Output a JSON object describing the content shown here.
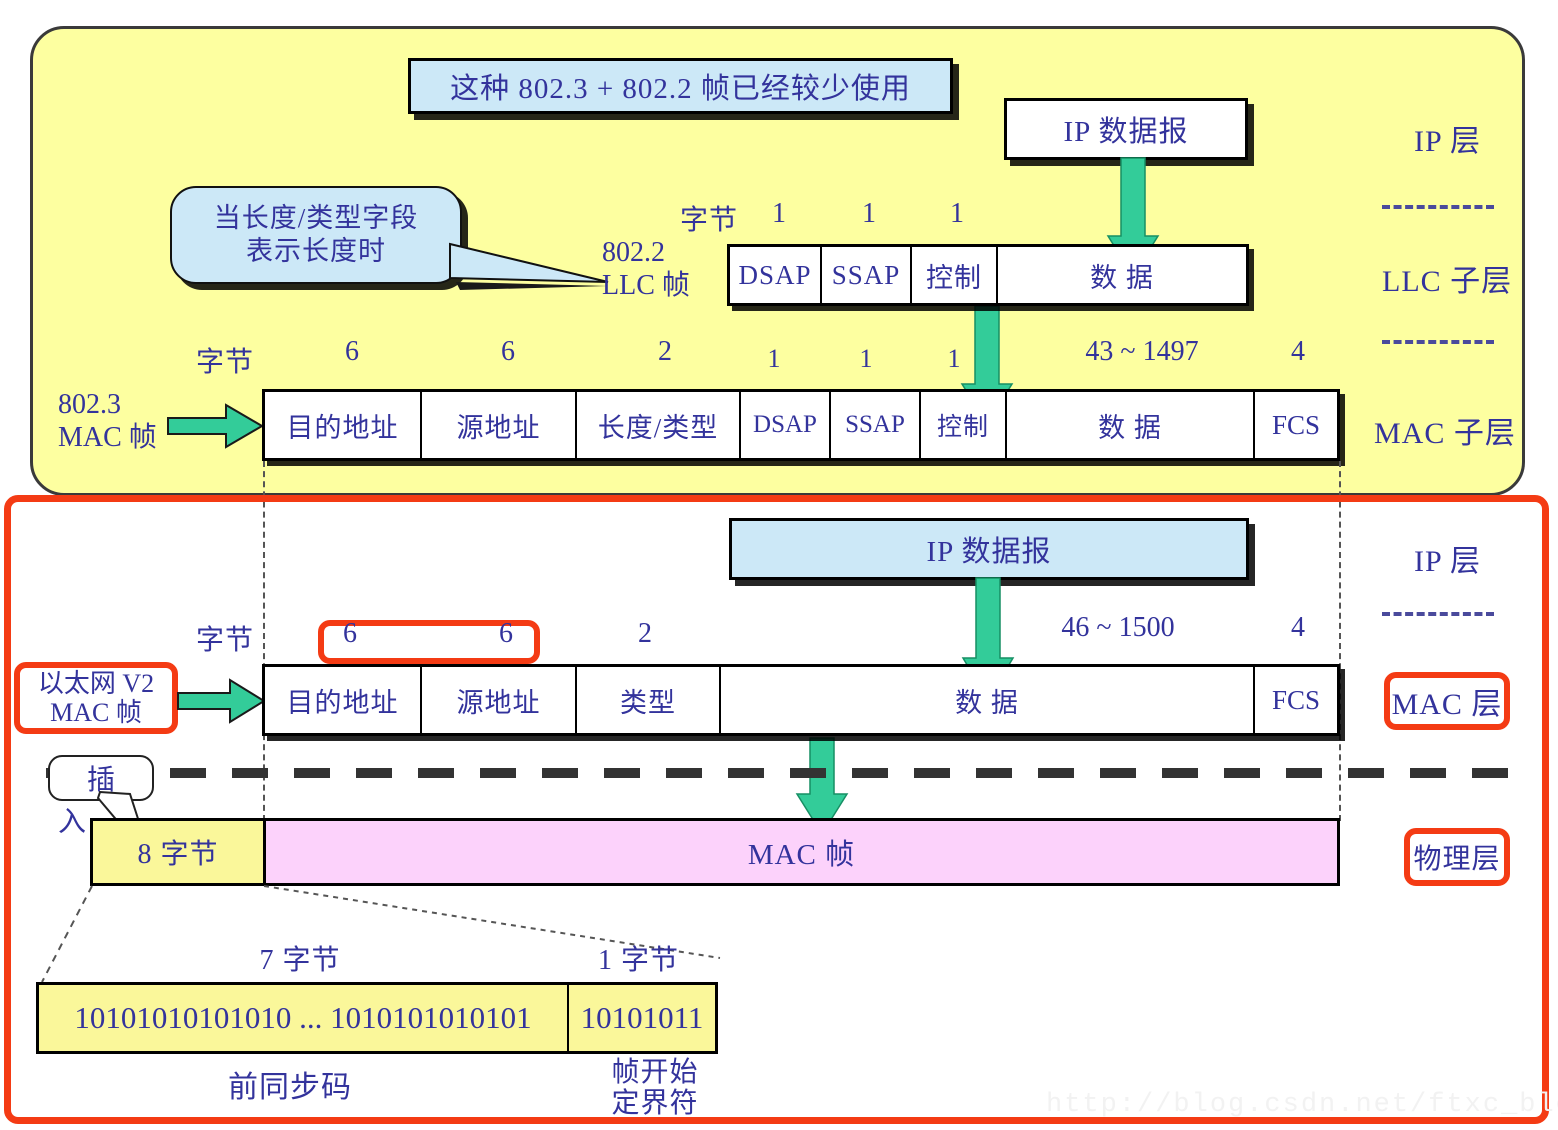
{
  "meta": {
    "watermark": "http://blog.csdn.net/ftxc_blog"
  },
  "top_section": {
    "note_banner": "这种 802.3 + 802.2 帧已经较少使用",
    "callout_length_field": "当长度/类型字段\n表示长度时",
    "ip_datagram_label": "IP 数据报",
    "layer_labels": {
      "ip": "IP 层",
      "llc": "LLC 子层",
      "mac": "MAC 子层"
    },
    "llc_frame": {
      "byte_label": "字节",
      "name_line1": "802.2",
      "name_line2": "LLC 帧",
      "byte_counts": [
        "1",
        "1",
        "1"
      ],
      "fields": [
        "DSAP",
        "SSAP",
        "控制",
        "数    据"
      ]
    },
    "mac_frame": {
      "byte_label": "字节",
      "name_line1": "802.3",
      "name_line2": "MAC 帧",
      "byte_counts": [
        "6",
        "6",
        "2",
        "1",
        "1",
        "1",
        "43 ~ 1497",
        "4"
      ],
      "fields": [
        "目的地址",
        "源地址",
        "长度/类型",
        "DSAP",
        "SSAP",
        "控制",
        "数    据",
        "FCS"
      ]
    }
  },
  "bottom_section": {
    "ip_datagram_label": "IP 数据报",
    "layer_labels": {
      "ip": "IP 层",
      "mac": "MAC 层",
      "physical": "物理层"
    },
    "ethernet_frame": {
      "byte_label": "字节",
      "name_line1": "以太网 V2",
      "name_line2": "MAC 帧",
      "byte_counts": [
        "6",
        "6",
        "2",
        "46 ~ 1500",
        "4"
      ],
      "fields": [
        "目的地址",
        "源地址",
        "类型",
        "数    据",
        "FCS"
      ]
    },
    "insert_callout": {
      "line1": "插",
      "line2": "入"
    },
    "physical_row": {
      "preamble_cell": "8 字节",
      "mac_frame_cell": "MAC 帧"
    },
    "preamble_detail": {
      "byte_label_left": "7 字节",
      "byte_label_right": "1 字节",
      "bits_left": "10101010101010 ... 1010101010101",
      "bits_right": "10101011",
      "name_left": "前同步码",
      "name_right": "帧开始\n定界符"
    }
  },
  "colors": {
    "panel_yellow": "#FDFFA0",
    "highlight_red": "#F43B14",
    "callout_blue": "#CCE8F7",
    "arrow_teal": "#33CC99",
    "text_blue": "#33339C",
    "pink_bar": "#FCD2FB",
    "preamble_yellow": "#FAF79A"
  }
}
